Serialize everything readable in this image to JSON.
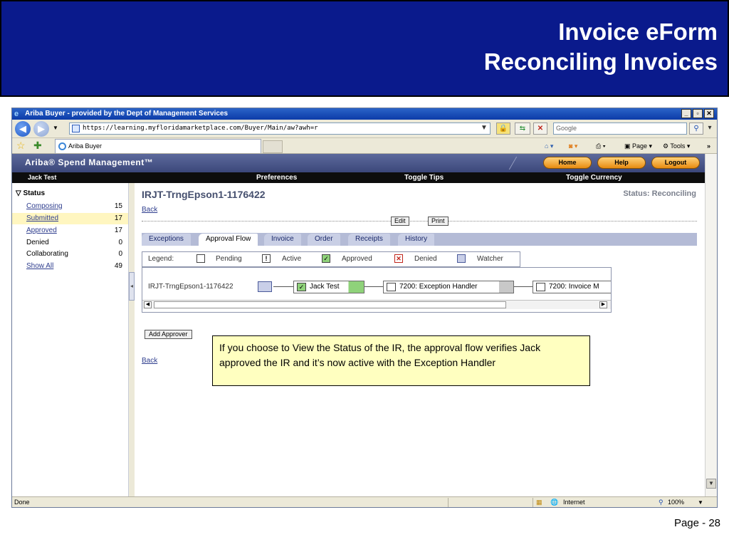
{
  "slide": {
    "title_line1": "Invoice eForm",
    "title_line2": "Reconciling Invoices",
    "page_number": "Page - 28"
  },
  "browser": {
    "window_title": "Ariba Buyer - provided by the Dept of Management Services",
    "address": "https://learning.myfloridamarketplace.com/Buyer/Main/aw?awh=r",
    "search_placeholder": "Google",
    "tab_label": "Ariba Buyer",
    "cmd_page": "Page",
    "cmd_tools": "Tools",
    "status_left": "Done",
    "status_zone": "Internet",
    "status_zoom": "100%"
  },
  "ariba": {
    "logo": "Ariba® Spend Management™",
    "buttons": {
      "home": "Home",
      "help": "Help",
      "logout": "Logout"
    },
    "menubar": {
      "user": "Jack Test",
      "preferences": "Preferences",
      "toggle_tips": "Toggle Tips",
      "toggle_currency": "Toggle Currency"
    },
    "sidebar": {
      "title": "Status",
      "items": [
        {
          "label": "Composing",
          "count": "15"
        },
        {
          "label": "Submitted",
          "count": "17"
        },
        {
          "label": "Approved",
          "count": "17"
        },
        {
          "label": "Denied",
          "count": "0"
        },
        {
          "label": "Collaborating",
          "count": "0"
        },
        {
          "label": "Show All",
          "count": "49"
        }
      ]
    },
    "document": {
      "title": "IRJT-TrngEpson1-1176422",
      "status": "Status: Reconciling",
      "back": "Back",
      "edit": "Edit",
      "print": "Print",
      "tabs": [
        "Exceptions",
        "Approval Flow",
        "Invoice",
        "Order",
        "Receipts",
        "History"
      ],
      "legend": {
        "label": "Legend:",
        "pending": "Pending",
        "active": "Active",
        "approved": "Approved",
        "denied": "Denied",
        "watcher": "Watcher"
      },
      "flow": {
        "label": "IRJT-TrngEpson1-1176422",
        "nodes": [
          "Jack Test",
          "7200: Exception Handler",
          "7200: Invoice M"
        ]
      },
      "add_approver": "Add Approver",
      "back_bottom": "Back"
    }
  },
  "callout": {
    "text": "If you choose to View the Status of the IR, the approval flow verifies Jack approved the IR and it’s now active with the Exception Handler"
  },
  "colors": {
    "slide_header": "#0a1a8c",
    "callout_bg": "#ffffc0",
    "approved_green": "#8fd27a",
    "active_grey": "#c8c8c8"
  }
}
